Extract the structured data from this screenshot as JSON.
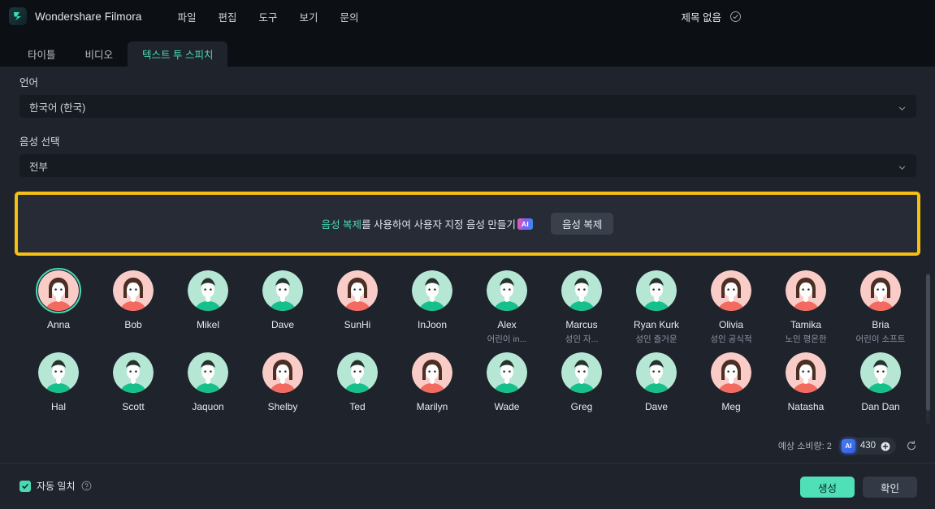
{
  "titlebar": {
    "logo_icon": "filmora-logo-icon",
    "app_title": "Wondershare Filmora",
    "menus": [
      "파일",
      "편집",
      "도구",
      "보기",
      "문의"
    ],
    "doc_name": "제목 없음",
    "saved_icon": "check-circle-icon"
  },
  "tabs": [
    {
      "label": "타이틀",
      "active": false
    },
    {
      "label": "비디오",
      "active": false
    },
    {
      "label": "텍스트 투 스피치",
      "active": true
    }
  ],
  "form": {
    "language_label": "언어",
    "language_value": "한국어 (한국)",
    "voice_label": "음성 선택",
    "voice_value": "전부",
    "chevron_icon": "chevron-down-icon"
  },
  "clone_box": {
    "highlight_color": "#f6bf13",
    "link_text": "음성 복제",
    "rest_text": "를 사용하여 사용자 지정 음성 만들기",
    "ai_badge": "AI",
    "button_label": "음성 복제"
  },
  "voices": [
    {
      "name": "Anna",
      "sub": "",
      "selected": true,
      "gender": "f",
      "ring": "#f9ccc7"
    },
    {
      "name": "Bob",
      "sub": "",
      "selected": false,
      "gender": "f",
      "ring": "#f9ccc7"
    },
    {
      "name": "Mikel",
      "sub": "",
      "selected": false,
      "gender": "m",
      "ring": "#b6e6d4"
    },
    {
      "name": "Dave",
      "sub": "",
      "selected": false,
      "gender": "m",
      "ring": "#b6e6d4"
    },
    {
      "name": "SunHi",
      "sub": "",
      "selected": false,
      "gender": "f",
      "ring": "#f9ccc7"
    },
    {
      "name": "InJoon",
      "sub": "",
      "selected": false,
      "gender": "m",
      "ring": "#b6e6d4"
    },
    {
      "name": "Alex",
      "sub": "어린이 in...",
      "selected": false,
      "gender": "m",
      "ring": "#b6e6d4"
    },
    {
      "name": "Marcus",
      "sub": "성인 자...",
      "selected": false,
      "gender": "m",
      "ring": "#b6e6d4"
    },
    {
      "name": "Ryan Kurk",
      "sub": "성인 즐거운",
      "selected": false,
      "gender": "m",
      "ring": "#b6e6d4"
    },
    {
      "name": "Olivia",
      "sub": "성인 공식적",
      "selected": false,
      "gender": "f",
      "ring": "#f9ccc7"
    },
    {
      "name": "Tamika",
      "sub": "노인 평온한",
      "selected": false,
      "gender": "f",
      "ring": "#f9ccc7"
    },
    {
      "name": "Bria",
      "sub": "어린이 소프트",
      "selected": false,
      "gender": "f",
      "ring": "#f9ccc7"
    },
    {
      "name": "Hal",
      "sub": "",
      "selected": false,
      "gender": "m",
      "ring": "#b6e6d4"
    },
    {
      "name": "Scott",
      "sub": "",
      "selected": false,
      "gender": "m",
      "ring": "#b6e6d4"
    },
    {
      "name": "Jaquon",
      "sub": "",
      "selected": false,
      "gender": "m",
      "ring": "#b6e6d4"
    },
    {
      "name": "Shelby",
      "sub": "",
      "selected": false,
      "gender": "f",
      "ring": "#f9ccc7"
    },
    {
      "name": "Ted",
      "sub": "",
      "selected": false,
      "gender": "m",
      "ring": "#b6e6d4"
    },
    {
      "name": "Marilyn",
      "sub": "",
      "selected": false,
      "gender": "f",
      "ring": "#f9ccc7"
    },
    {
      "name": "Wade",
      "sub": "",
      "selected": false,
      "gender": "m",
      "ring": "#b6e6d4"
    },
    {
      "name": "Greg",
      "sub": "",
      "selected": false,
      "gender": "m",
      "ring": "#b6e6d4"
    },
    {
      "name": "Dave",
      "sub": "",
      "selected": false,
      "gender": "m",
      "ring": "#b6e6d4"
    },
    {
      "name": "Meg",
      "sub": "",
      "selected": false,
      "gender": "f",
      "ring": "#f9ccc7"
    },
    {
      "name": "Natasha",
      "sub": "",
      "selected": false,
      "gender": "f",
      "ring": "#f9ccc7"
    },
    {
      "name": "Dan Dan",
      "sub": "",
      "selected": false,
      "gender": "m",
      "ring": "#b6e6d4"
    }
  ],
  "credits": {
    "label": "예상 소비량: 2",
    "ai_chip": "AI",
    "amount": "430",
    "plus_icon": "plus-circle-icon",
    "refresh_icon": "refresh-icon"
  },
  "footer": {
    "automatch_label": "자동 일치",
    "automatch_checked": true,
    "help_icon": "help-circle-icon",
    "generate_label": "생성",
    "confirm_label": "확인",
    "accent_color": "#4fe0b8"
  }
}
